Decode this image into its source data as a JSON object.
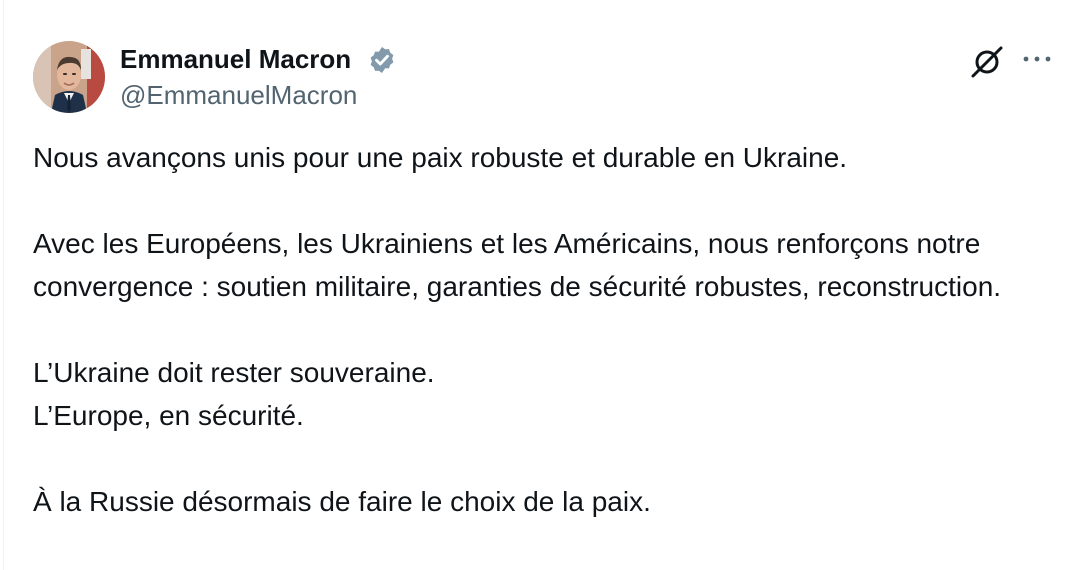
{
  "author": {
    "name": "Emmanuel Macron",
    "handle": "@EmmanuelMacron",
    "verified": true
  },
  "tweet": {
    "paragraphs": [
      {
        "lines": [
          "Nous avançons unis pour une paix robuste et durable en Ukraine."
        ]
      },
      {
        "lines": [
          "Avec les Européens, les Ukrainiens et les Américains, nous renforçons notre convergence : soutien militaire, garanties de sécurité robustes, reconstruction."
        ]
      },
      {
        "lines": [
          "L’Ukraine doit rester souveraine.",
          "L’Europe, en sécurité."
        ]
      },
      {
        "lines": [
          "À la Russie désormais de faire le choix de la paix."
        ]
      }
    ]
  },
  "icons": {
    "verified": "verified-badge-icon",
    "grok": "grok-icon",
    "more": "more-options-icon"
  },
  "colors": {
    "text": "#0f1419",
    "secondary": "#536471",
    "verified_badge": "#829aab",
    "border": "#eff3f4"
  }
}
